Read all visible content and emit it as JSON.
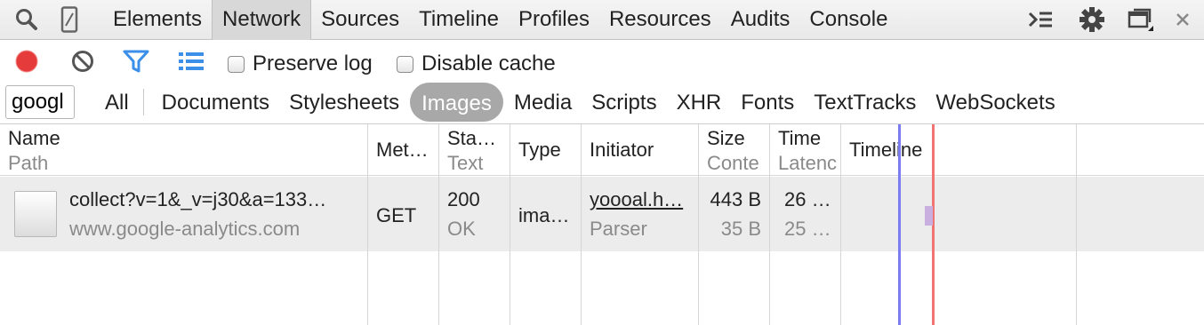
{
  "tabs": [
    "Elements",
    "Network",
    "Sources",
    "Timeline",
    "Profiles",
    "Resources",
    "Audits",
    "Console"
  ],
  "active_tab": "Network",
  "toolbar": {
    "preserve_log_label": "Preserve log",
    "disable_cache_label": "Disable cache",
    "record_color": "#e53b3b",
    "filter_icon_color": "#3b8fe8"
  },
  "filter": {
    "value": "googl",
    "types": [
      "All",
      "Documents",
      "Stylesheets",
      "Images",
      "Media",
      "Scripts",
      "XHR",
      "Fonts",
      "TextTracks",
      "WebSockets"
    ],
    "active_type": "Images"
  },
  "columns": {
    "name": {
      "title": "Name",
      "subtitle": "Path"
    },
    "method": {
      "title": "Met…"
    },
    "status": {
      "title": "Sta…",
      "subtitle": "Text"
    },
    "type": {
      "title": "Type"
    },
    "initiator": {
      "title": "Initiator"
    },
    "size": {
      "title": "Size",
      "subtitle": "Conte"
    },
    "time": {
      "title": "Time",
      "subtitle": "Latenc"
    },
    "timeline": {
      "title": "Timeline"
    }
  },
  "requests": [
    {
      "name": "collect?v=1&_v=j30&a=133…",
      "path": "www.google-analytics.com",
      "method": "GET",
      "status": "200",
      "status_text": "OK",
      "type": "ima…",
      "initiator": "yoooal.h…",
      "initiator_type": "Parser",
      "size": "443 B",
      "content": "35 B",
      "time": "26 …",
      "latency": "25 …"
    }
  ],
  "timeline_colors": {
    "dom_content_loaded": "#7b7bf2",
    "load": "#f07474",
    "bar": "#c9aee0"
  }
}
